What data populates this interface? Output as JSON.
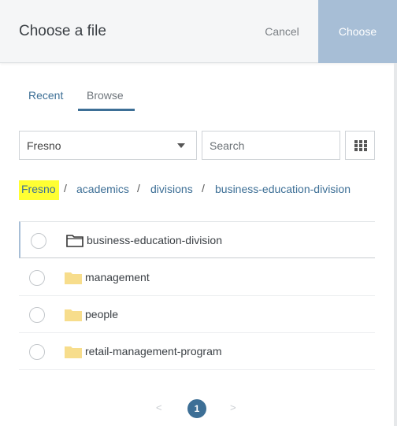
{
  "dialog": {
    "title": "Choose a file",
    "cancel_label": "Cancel",
    "choose_label": "Choose"
  },
  "tabs": {
    "recent": "Recent",
    "browse": "Browse",
    "active": "Browse"
  },
  "filters": {
    "site_select": "Fresno",
    "search_placeholder": "Search",
    "view_toggle_icon": "grid-icon"
  },
  "breadcrumb": {
    "items": [
      "Fresno",
      "academics",
      "divisions",
      "business-education-division"
    ],
    "separator": "/"
  },
  "items": [
    {
      "name": "business-education-division",
      "icon": "folder-outline-icon",
      "selected": true
    },
    {
      "name": "management",
      "icon": "folder-icon"
    },
    {
      "name": "people",
      "icon": "folder-icon"
    },
    {
      "name": "retail-management-program",
      "icon": "folder-icon"
    }
  ],
  "pagination": {
    "prev": "<",
    "current": "1",
    "next": ">"
  },
  "colors": {
    "accent": "#3d6f96",
    "choose_button": "#a7bed6",
    "highlight": "#ffff33",
    "folder_fill": "#f7dd8c"
  }
}
